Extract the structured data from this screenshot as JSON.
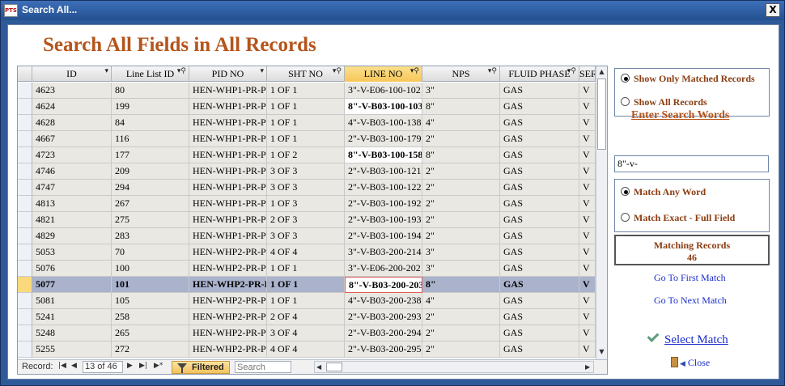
{
  "window": {
    "title": "Search All...",
    "app_icon_text": "PTS",
    "close_glyph": "X"
  },
  "heading": "Search All Fields in All Records",
  "grid": {
    "columns": [
      {
        "label": "ID",
        "filtered": false
      },
      {
        "label": "Line List ID",
        "filtered": true
      },
      {
        "label": "PID NO",
        "filtered": false
      },
      {
        "label": "SHT NO",
        "filtered": true
      },
      {
        "label": "LINE NO",
        "filtered": true,
        "active": true
      },
      {
        "label": "NPS",
        "filtered": true
      },
      {
        "label": "FLUID PHASE",
        "filtered": true
      },
      {
        "label": "SER",
        "filtered": false
      }
    ],
    "rows": [
      {
        "id": "4623",
        "line_list_id": "80",
        "pid_no": "HEN-WHP1-PR-P",
        "sht_no": "1 OF 1",
        "line_no": "3\"-V-E06-100-102",
        "nps": "3\"",
        "fluid_phase": "GAS",
        "ser": "V"
      },
      {
        "id": "4624",
        "line_list_id": "199",
        "pid_no": "HEN-WHP1-PR-P",
        "sht_no": "1 OF 1",
        "line_no": "8\"-V-B03-100-103",
        "nps": "8\"",
        "fluid_phase": "GAS",
        "ser": "V",
        "line_bold": true
      },
      {
        "id": "4628",
        "line_list_id": "84",
        "pid_no": "HEN-WHP1-PR-P",
        "sht_no": "1 OF 1",
        "line_no": "4\"-V-B03-100-138",
        "nps": "4\"",
        "fluid_phase": "GAS",
        "ser": "V"
      },
      {
        "id": "4667",
        "line_list_id": "116",
        "pid_no": "HEN-WHP1-PR-P",
        "sht_no": "1 OF 1",
        "line_no": "2\"-V-B03-100-179",
        "nps": "2\"",
        "fluid_phase": "GAS",
        "ser": "V"
      },
      {
        "id": "4723",
        "line_list_id": "177",
        "pid_no": "HEN-WHP1-PR-P",
        "sht_no": "1 OF 2",
        "line_no": "8\"-V-B03-100-158",
        "nps": "8\"",
        "fluid_phase": "GAS",
        "ser": "V",
        "line_bold": true
      },
      {
        "id": "4746",
        "line_list_id": "209",
        "pid_no": "HEN-WHP1-PR-P",
        "sht_no": "3 OF 3",
        "line_no": "2\"-V-B03-100-121",
        "nps": "2\"",
        "fluid_phase": "GAS",
        "ser": "V"
      },
      {
        "id": "4747",
        "line_list_id": "294",
        "pid_no": "HEN-WHP1-PR-P",
        "sht_no": "3 OF 3",
        "line_no": "2\"-V-B03-100-122",
        "nps": "2\"",
        "fluid_phase": "GAS",
        "ser": "V"
      },
      {
        "id": "4813",
        "line_list_id": "267",
        "pid_no": "HEN-WHP1-PR-P",
        "sht_no": "1 OF 3",
        "line_no": "2\"-V-B03-100-192",
        "nps": "2\"",
        "fluid_phase": "GAS",
        "ser": "V"
      },
      {
        "id": "4821",
        "line_list_id": "275",
        "pid_no": "HEN-WHP1-PR-P",
        "sht_no": "2 OF 3",
        "line_no": "2\"-V-B03-100-193",
        "nps": "2\"",
        "fluid_phase": "GAS",
        "ser": "V"
      },
      {
        "id": "4829",
        "line_list_id": "283",
        "pid_no": "HEN-WHP1-PR-P",
        "sht_no": "3 OF 3",
        "line_no": "2\"-V-B03-100-194",
        "nps": "2\"",
        "fluid_phase": "GAS",
        "ser": "V"
      },
      {
        "id": "5053",
        "line_list_id": "70",
        "pid_no": "HEN-WHP2-PR-P",
        "sht_no": "4 OF 4",
        "line_no": "3\"-V-B03-200-214",
        "nps": "3\"",
        "fluid_phase": "GAS",
        "ser": "V"
      },
      {
        "id": "5076",
        "line_list_id": "100",
        "pid_no": "HEN-WHP2-PR-P",
        "sht_no": "1 OF 1",
        "line_no": "3\"-V-E06-200-202",
        "nps": "3\"",
        "fluid_phase": "GAS",
        "ser": "V"
      },
      {
        "id": "5077",
        "line_list_id": "101",
        "pid_no": "HEN-WHP2-PR-P",
        "sht_no": "1 OF 1",
        "line_no": "8\"-V-B03-200-203",
        "nps": "8\"",
        "fluid_phase": "GAS",
        "ser": "V",
        "current": true
      },
      {
        "id": "5081",
        "line_list_id": "105",
        "pid_no": "HEN-WHP2-PR-P",
        "sht_no": "1 OF 1",
        "line_no": "4\"-V-B03-200-238",
        "nps": "4\"",
        "fluid_phase": "GAS",
        "ser": "V"
      },
      {
        "id": "5241",
        "line_list_id": "258",
        "pid_no": "HEN-WHP2-PR-P",
        "sht_no": "2 OF 4",
        "line_no": "2\"-V-B03-200-293",
        "nps": "2\"",
        "fluid_phase": "GAS",
        "ser": "V"
      },
      {
        "id": "5248",
        "line_list_id": "265",
        "pid_no": "HEN-WHP2-PR-P",
        "sht_no": "3 OF 4",
        "line_no": "2\"-V-B03-200-294",
        "nps": "2\"",
        "fluid_phase": "GAS",
        "ser": "V"
      },
      {
        "id": "5255",
        "line_list_id": "272",
        "pid_no": "HEN-WHP2-PR-P",
        "sht_no": "4 OF 4",
        "line_no": "2\"-V-B03-200-295",
        "nps": "2\"",
        "fluid_phase": "GAS",
        "ser": "V"
      }
    ],
    "nav": {
      "record_label": "Record:",
      "position": "13 of 46",
      "filtered_label": "Filtered",
      "search_placeholder": "Search"
    }
  },
  "filter_options": {
    "show_matched": "Show Only Matched Records",
    "show_all": "Show All Records",
    "selected": "show_matched"
  },
  "search": {
    "label": "Enter Search Words",
    "value": "8\"-v-"
  },
  "match_options": {
    "any_word": "Match Any Word",
    "exact": "Match Exact - Full Field",
    "selected": "any_word"
  },
  "matching": {
    "label": "Matching Records",
    "count": "46"
  },
  "actions": {
    "first_match": "Go To First Match",
    "next_match": "Go To Next Match",
    "select_match": "Select Match",
    "close": "Close"
  },
  "colors": {
    "title_bar": "#23508f",
    "heading": "#b5541b",
    "option_text": "#8a3d12",
    "link": "#1a2ecc",
    "current_row": "#aab2cc",
    "active_header": "#f7c65a"
  }
}
